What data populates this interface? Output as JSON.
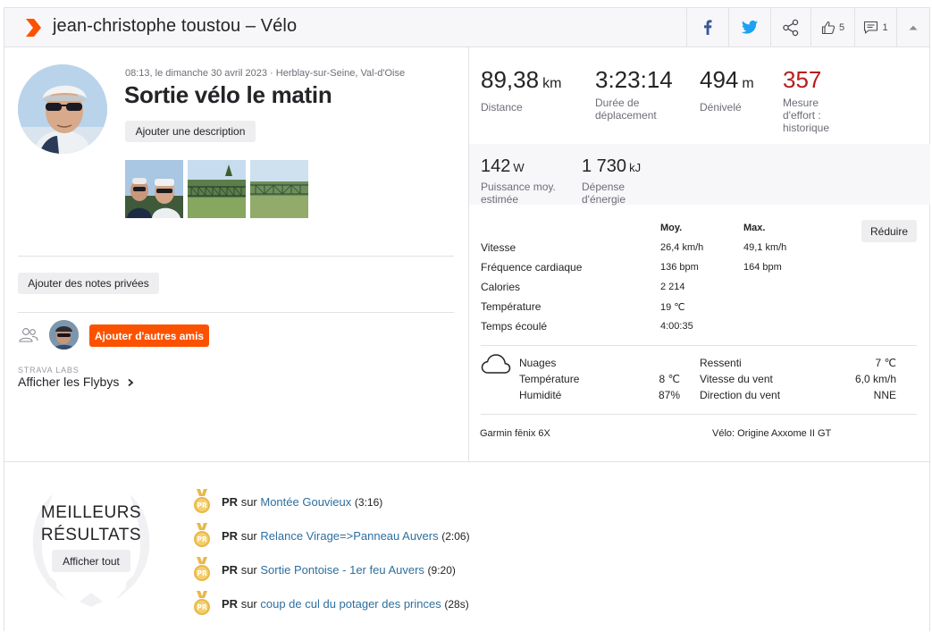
{
  "header": {
    "title": "jean-christophe toustou – Vélo",
    "like_count": "5",
    "comment_count": "1"
  },
  "activity": {
    "meta": "08:13, le dimanche 30 avril 2023 · Herblay-sur-Seine, Val-d'Oise",
    "name": "Sortie vélo le matin",
    "add_description_label": "Ajouter une description",
    "add_private_notes_label": "Ajouter des notes privées",
    "add_friends_label": "Ajouter d'autres amis",
    "labs_tag": "STRAVA LABS",
    "flyby_label": "Afficher les Flybys"
  },
  "stats": {
    "distance": {
      "value": "89,38",
      "unit": "km",
      "label": "Distance"
    },
    "moving_time": {
      "value": "3:23:14",
      "label": "Durée de déplacement"
    },
    "elevation": {
      "value": "494",
      "unit": "m",
      "label": "Dénivelé"
    },
    "effort": {
      "value": "357",
      "label": "Mesure d'effort : historique"
    },
    "power": {
      "value": "142",
      "unit": "W",
      "label": "Puissance moy. estimée"
    },
    "energy": {
      "value": "1 730",
      "unit": "kJ",
      "label": "Dépense d'énergie"
    }
  },
  "details": {
    "col_avg": "Moy.",
    "col_max": "Max.",
    "reduce_label": "Réduire",
    "rows": [
      {
        "label": "Vitesse",
        "avg": "26,4 km/h",
        "max": "49,1 km/h"
      },
      {
        "label": "Fréquence cardiaque",
        "avg": "136 bpm",
        "max": "164 bpm"
      },
      {
        "label": "Calories",
        "avg": "2 214",
        "max": ""
      },
      {
        "label": "Température",
        "avg": "19 ℃",
        "max": ""
      },
      {
        "label": "Temps écoulé",
        "avg": "4:00:35",
        "max": ""
      }
    ]
  },
  "weather": {
    "condition": "Nuages",
    "temp_label": "Température",
    "temp_value": "8 ℃",
    "humidity_label": "Humidité",
    "humidity_value": "87%",
    "feels_label": "Ressenti",
    "feels_value": "7 ℃",
    "wind_speed_label": "Vitesse du vent",
    "wind_speed_value": "6,0 km/h",
    "wind_dir_label": "Direction du vent",
    "wind_dir_value": "NNE"
  },
  "equipment": {
    "device": "Garmin fēnix 6X",
    "bike": "Vélo: Origine Axxome II GT"
  },
  "best_efforts": {
    "title_line1": "MEILLEURS",
    "title_line2": "RÉSULTATS",
    "show_all_label": "Afficher tout",
    "items": [
      {
        "badge": "PR",
        "prefix": "sur",
        "segment": "Montée Gouvieux",
        "time": "(3:16)"
      },
      {
        "badge": "PR",
        "prefix": "sur",
        "segment": "Relance Virage=>Panneau Auvers",
        "time": "(2:06)"
      },
      {
        "badge": "PR",
        "prefix": "sur",
        "segment": "Sortie Pontoise - 1er feu Auvers",
        "time": "(9:20)"
      },
      {
        "badge": "PR",
        "prefix": "sur",
        "segment": "coup de cul du potager des princes",
        "time": "(28s)"
      }
    ]
  },
  "colors": {
    "brand": "#fc5200",
    "effort_red": "#b71c1c",
    "link": "#2d6f9f",
    "medal": "#e9b84a"
  },
  "icons": [
    "strava-chevron-icon",
    "facebook-icon",
    "twitter-icon",
    "share-icon",
    "kudos-thumb-icon",
    "comment-icon",
    "collapse-caret-icon",
    "friends-icon",
    "cloud-icon",
    "laurel-wreath-icon",
    "pr-medal-icon",
    "chevron-right-icon"
  ]
}
